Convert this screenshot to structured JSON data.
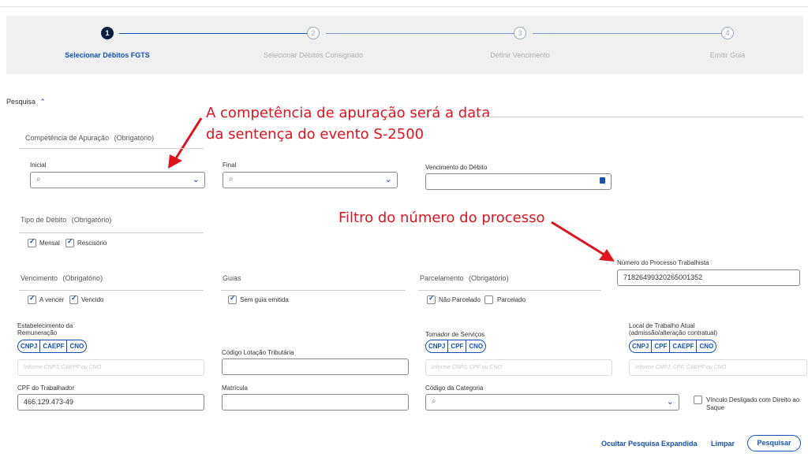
{
  "steps": [
    {
      "number": "1",
      "label": "Selecionar Débitos FGTS"
    },
    {
      "number": "2",
      "label": "Selecionar Débitos Consignado"
    },
    {
      "number": "3",
      "label": "Definir Vencimento"
    },
    {
      "number": "4",
      "label": "Emitir Guia"
    }
  ],
  "search_toggle": {
    "label": "Pesquisa",
    "icon": "chevron-up-icon"
  },
  "annotations": {
    "line1": "A competência de apuração será a data",
    "line2": "da sentença do evento S-2500",
    "process": "Filtro do número do processo",
    "color": "#e0131f"
  },
  "competencia": {
    "title": "Competência de Apuração",
    "required": "(Obrigatório)",
    "inicial_label": "Inicial",
    "final_label": "Final",
    "vencimento_debito_label": "Vencimento do Débito"
  },
  "tipo_debito": {
    "title": "Tipo de Débito",
    "required": "(Obrigatório)",
    "options": [
      {
        "label": "Mensal",
        "checked": true
      },
      {
        "label": "Rescisório",
        "checked": true
      }
    ]
  },
  "processo": {
    "label": "Número do Processo Trabalhista",
    "value": "71826499320265001352"
  },
  "vencimento": {
    "title": "Vencimento",
    "required": "(Obrigatório)",
    "options": [
      {
        "label": "A vencer",
        "checked": true
      },
      {
        "label": "Vencido",
        "checked": true
      }
    ]
  },
  "guias": {
    "title": "Guias",
    "options": [
      {
        "label": "Sem guia emitida",
        "checked": true
      }
    ]
  },
  "parcelamento": {
    "title": "Parcelamento",
    "required": "(Obrigatório)",
    "options": [
      {
        "label": "Não Parcelado",
        "checked": true
      },
      {
        "label": "Parcelado",
        "checked": false
      }
    ]
  },
  "estabelecimento": {
    "label_line1": "Estabelecimento da",
    "label_line2": "Remuneração",
    "types": [
      "CNPJ",
      "CAEPF",
      "CNO"
    ],
    "placeholder": "Informe CNPJ, CAEPF ou CNO"
  },
  "lotacao": {
    "label": "Código Lotação Tributária",
    "value": ""
  },
  "tomador": {
    "label": "Tomador de Serviços",
    "types": [
      "CNPJ",
      "CPF",
      "CNO"
    ],
    "placeholder": "Informe CNPJ, CPF ou CNO"
  },
  "local_trabalho": {
    "label_line1": "Local de Trabalho Atual",
    "label_line2": "(admissão/alteração contratual)",
    "types": [
      "CNPJ",
      "CPF",
      "CAEPF",
      "CNO"
    ],
    "placeholder": "Informe CNPJ, CPF, CAEPF ou CNO"
  },
  "cpf": {
    "label": "CPF do Trabalhador",
    "value": "466.129.473-49"
  },
  "matricula": {
    "label": "Matrícula",
    "value": ""
  },
  "categoria": {
    "label": "Código da Categoria"
  },
  "vinculo": {
    "line1": "Vínculo Desligado com Direito ao",
    "line2": "Saque",
    "checked": false
  },
  "actions": {
    "hide": "Ocultar Pesquisa Expandida",
    "clear": "Limpar",
    "search": "Pesquisar"
  },
  "colors": {
    "primary": "#1351b4",
    "active_step": "#071d41",
    "annotation": "#e0131f"
  }
}
